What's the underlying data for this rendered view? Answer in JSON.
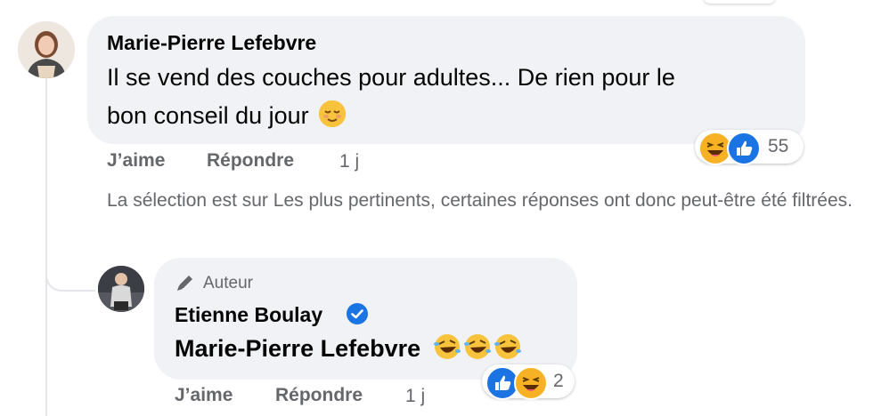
{
  "comment": {
    "author": "Marie-Pierre Lefebvre",
    "text_line1": "Il se vend des couches pour adultes... De rien pour le",
    "text_line2": "bon conseil du jour",
    "reaction_count": "55",
    "like_label": "J’aime",
    "reply_label": "Répondre",
    "time": "1 j"
  },
  "filter_notice": "La sélection est sur Les plus pertinents, certaines réponses ont donc peut-être été filtrées.",
  "reply": {
    "badge": "Auteur",
    "author": "Etienne Boulay",
    "verified": true,
    "text": "Marie-Pierre Lefebvre",
    "reaction_count": "2",
    "like_label": "J’aime",
    "reply_label": "Répondre",
    "time": "1 j"
  },
  "icons": {
    "verified": "verified-badge-icon",
    "author_badge": "pencil-icon",
    "reaction_like": "like-icon",
    "reaction_haha": "haha-icon",
    "emoji_relieved": "relieved-face-emoji",
    "emoji_laugh": "rolling-laughing-emoji"
  },
  "colors": {
    "bubble": "#f0f2f5",
    "muted_text": "#65676b",
    "accent": "#1b74e4",
    "haha": "#f7b125"
  }
}
